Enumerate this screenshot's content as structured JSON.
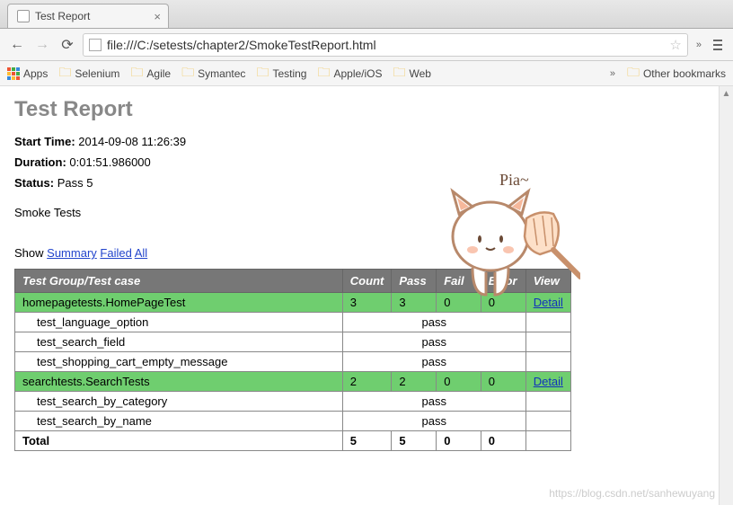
{
  "browser": {
    "tab_title": "Test Report",
    "url": "file:///C:/setests/chapter2/SmokeTestReport.html",
    "bookmarks": {
      "apps_label": "Apps",
      "items": [
        "Selenium",
        "Agile",
        "Symantec",
        "Testing",
        "Apple/iOS",
        "Web"
      ],
      "other": "Other bookmarks"
    }
  },
  "report": {
    "title": "Test Report",
    "start_label": "Start Time:",
    "start_value": "2014-09-08 11:26:39",
    "duration_label": "Duration:",
    "duration_value": "0:01:51.986000",
    "status_label": "Status:",
    "status_value": "Pass 5",
    "suite": "Smoke Tests",
    "show_label": "Show",
    "show_links": [
      "Summary",
      "Failed",
      "All"
    ]
  },
  "table": {
    "headers": [
      "Test Group/Test case",
      "Count",
      "Pass",
      "Fail",
      "Error",
      "View"
    ],
    "groups": [
      {
        "name": "homepagetests.HomePageTest",
        "count": "3",
        "pass": "3",
        "fail": "0",
        "error": "0",
        "view": "Detail",
        "cases": [
          {
            "name": "test_language_option",
            "result": "pass"
          },
          {
            "name": "test_search_field",
            "result": "pass"
          },
          {
            "name": "test_shopping_cart_empty_message",
            "result": "pass"
          }
        ]
      },
      {
        "name": "searchtests.SearchTests",
        "count": "2",
        "pass": "2",
        "fail": "0",
        "error": "0",
        "view": "Detail",
        "cases": [
          {
            "name": "test_search_by_category",
            "result": "pass"
          },
          {
            "name": "test_search_by_name",
            "result": "pass"
          }
        ]
      }
    ],
    "total": {
      "label": "Total",
      "count": "5",
      "pass": "5",
      "fail": "0",
      "error": "0"
    }
  },
  "cat_text": "Pia~",
  "watermark": "https://blog.csdn.net/sanhewuyang"
}
